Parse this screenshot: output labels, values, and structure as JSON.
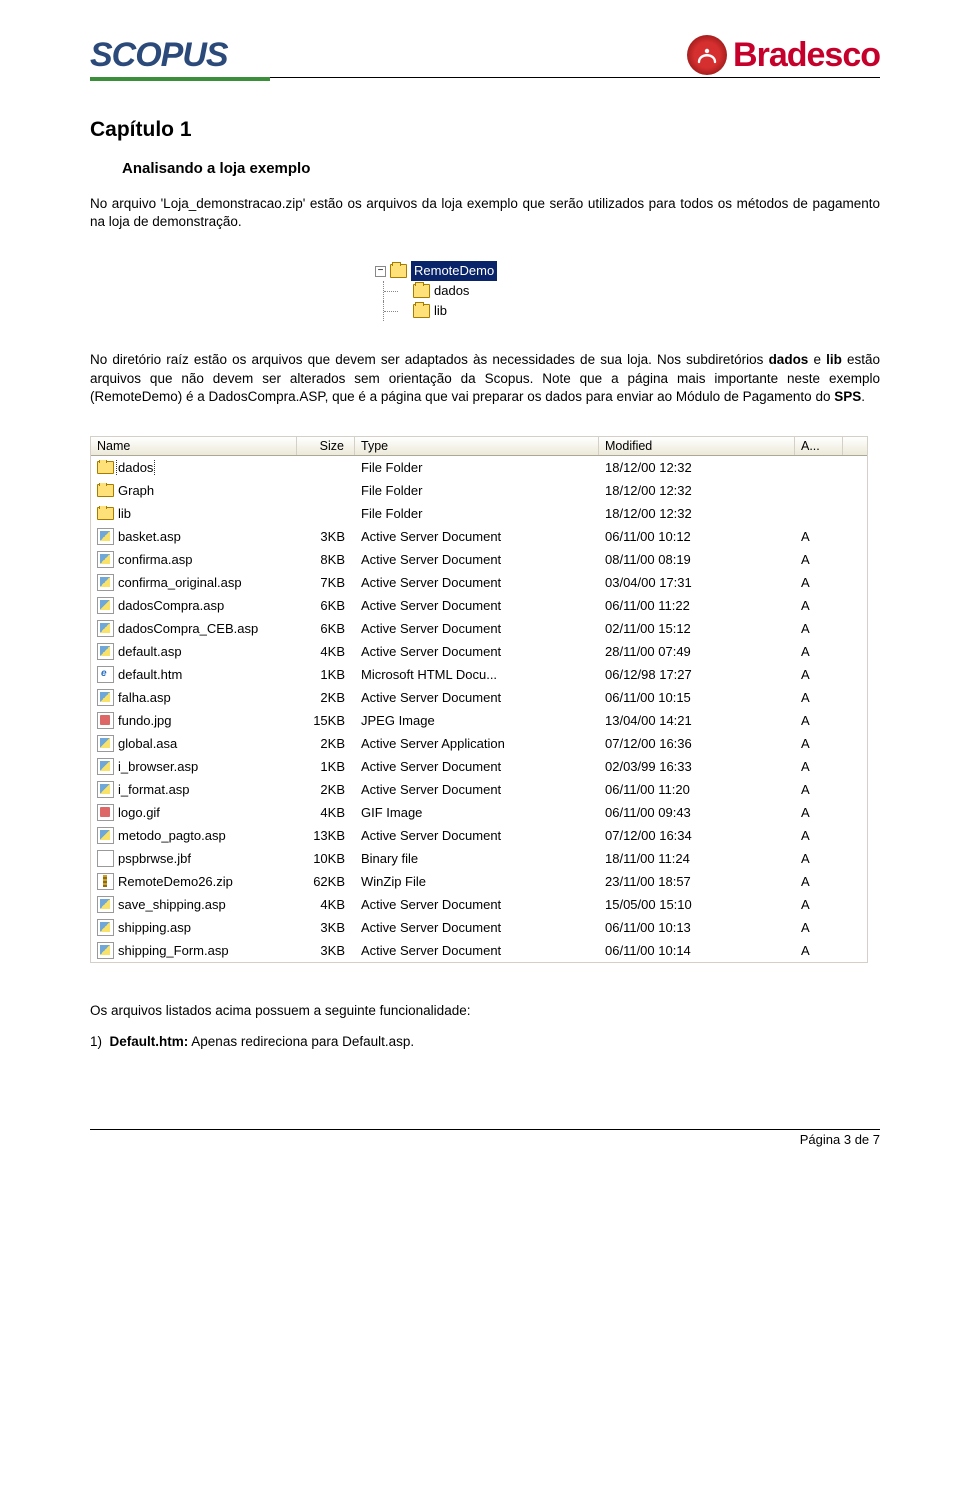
{
  "header": {
    "left_logo_text": "SCOPUS",
    "right_logo_text": "Bradesco"
  },
  "chapter_title": "Capítulo 1",
  "section_title": "Analisando a loja exemplo",
  "para1_prefix": "No arquivo 'Loja_demonstracao.zip' estão os arquivos da loja exemplo que serão utilizados para todos os métodos de pagamento na loja de demonstração.",
  "tree": {
    "root": "RemoteDemo",
    "children": [
      "dados",
      "lib"
    ]
  },
  "para2_html_parts": {
    "t1": "No diretório raíz estão os arquivos que devem ser adaptados às necessidades de sua loja. Nos subdiretórios ",
    "b1": "dados",
    "t2": " e ",
    "b2": "lib",
    "t3": " estão arquivos que não devem ser alterados sem orientação da Scopus. Note que a página mais importante neste exemplo (RemoteDemo) é a DadosCompra.ASP, que é a página que vai preparar os dados para enviar ao Módulo de Pagamento do ",
    "b3": "SPS",
    "t4": "."
  },
  "columns": {
    "name": "Name",
    "size": "Size",
    "type": "Type",
    "modified": "Modified",
    "a": "A..."
  },
  "files": [
    {
      "icon": "folder",
      "name": "dados",
      "size": "",
      "type": "File Folder",
      "modified": "18/12/00 12:32",
      "a": "",
      "sel": true
    },
    {
      "icon": "folder",
      "name": "Graph",
      "size": "",
      "type": "File Folder",
      "modified": "18/12/00 12:32",
      "a": ""
    },
    {
      "icon": "folder",
      "name": "lib",
      "size": "",
      "type": "File Folder",
      "modified": "18/12/00 12:32",
      "a": ""
    },
    {
      "icon": "asp",
      "name": "basket.asp",
      "size": "3KB",
      "type": "Active Server Document",
      "modified": "06/11/00 10:12",
      "a": "A"
    },
    {
      "icon": "asp",
      "name": "confirma.asp",
      "size": "8KB",
      "type": "Active Server Document",
      "modified": "08/11/00 08:19",
      "a": "A"
    },
    {
      "icon": "asp",
      "name": "confirma_original.asp",
      "size": "7KB",
      "type": "Active Server Document",
      "modified": "03/04/00 17:31",
      "a": "A"
    },
    {
      "icon": "asp",
      "name": "dadosCompra.asp",
      "size": "6KB",
      "type": "Active Server Document",
      "modified": "06/11/00 11:22",
      "a": "A"
    },
    {
      "icon": "asp",
      "name": "dadosCompra_CEB.asp",
      "size": "6KB",
      "type": "Active Server Document",
      "modified": "02/11/00 15:12",
      "a": "A"
    },
    {
      "icon": "asp",
      "name": "default.asp",
      "size": "4KB",
      "type": "Active Server Document",
      "modified": "28/11/00 07:49",
      "a": "A"
    },
    {
      "icon": "htm",
      "name": "default.htm",
      "size": "1KB",
      "type": "Microsoft HTML Docu...",
      "modified": "06/12/98 17:27",
      "a": "A"
    },
    {
      "icon": "asp",
      "name": "falha.asp",
      "size": "2KB",
      "type": "Active Server Document",
      "modified": "06/11/00 10:15",
      "a": "A"
    },
    {
      "icon": "img",
      "name": "fundo.jpg",
      "size": "15KB",
      "type": "JPEG Image",
      "modified": "13/04/00 14:21",
      "a": "A"
    },
    {
      "icon": "asp",
      "name": "global.asa",
      "size": "2KB",
      "type": "Active Server Application",
      "modified": "07/12/00 16:36",
      "a": "A"
    },
    {
      "icon": "asp",
      "name": "i_browser.asp",
      "size": "1KB",
      "type": "Active Server Document",
      "modified": "02/03/99 16:33",
      "a": "A"
    },
    {
      "icon": "asp",
      "name": "i_format.asp",
      "size": "2KB",
      "type": "Active Server Document",
      "modified": "06/11/00 11:20",
      "a": "A"
    },
    {
      "icon": "img",
      "name": "logo.gif",
      "size": "4KB",
      "type": "GIF Image",
      "modified": "06/11/00 09:43",
      "a": "A"
    },
    {
      "icon": "asp",
      "name": "metodo_pagto.asp",
      "size": "13KB",
      "type": "Active Server Document",
      "modified": "07/12/00 16:34",
      "a": "A"
    },
    {
      "icon": "bin",
      "name": "pspbrwse.jbf",
      "size": "10KB",
      "type": "Binary file",
      "modified": "18/11/00 11:24",
      "a": "A"
    },
    {
      "icon": "zip",
      "name": "RemoteDemo26.zip",
      "size": "62KB",
      "type": "WinZip File",
      "modified": "23/11/00 18:57",
      "a": "A"
    },
    {
      "icon": "asp",
      "name": "save_shipping.asp",
      "size": "4KB",
      "type": "Active Server Document",
      "modified": "15/05/00 15:10",
      "a": "A"
    },
    {
      "icon": "asp",
      "name": "shipping.asp",
      "size": "3KB",
      "type": "Active Server Document",
      "modified": "06/11/00 10:13",
      "a": "A"
    },
    {
      "icon": "asp",
      "name": "shipping_Form.asp",
      "size": "3KB",
      "type": "Active Server Document",
      "modified": "06/11/00 10:14",
      "a": "A"
    }
  ],
  "footer_line": "Os arquivos listados acima possuem a seguinte funcionalidade:",
  "list1_num": "1)",
  "list1_bold": "Default.htm:",
  "list1_rest": " Apenas redireciona para Default.asp.",
  "page_num": "Página 3 de 7"
}
